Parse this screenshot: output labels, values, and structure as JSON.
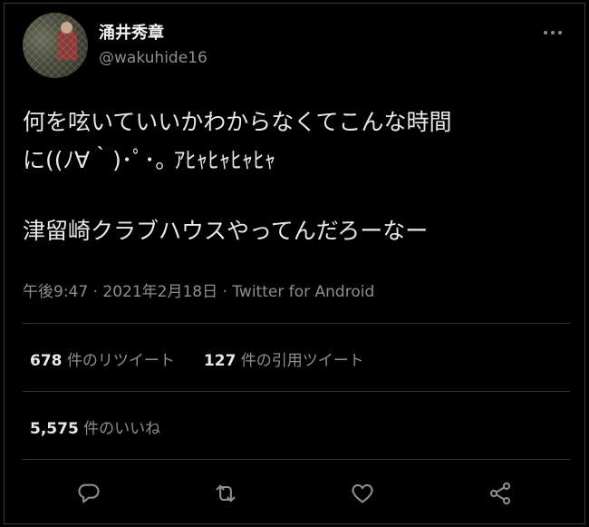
{
  "user": {
    "display_name": "涌井秀章",
    "handle": "@wakuhide16"
  },
  "tweet": {
    "line1": "何を呟いていいかわからなくてこんな時間",
    "line2": "に((ﾉ∀｀)･ﾟ･｡ ｱﾋｬﾋｬﾋｬﾋｬ",
    "line3": "津留崎クラブハウスやってんだろーなー"
  },
  "meta": {
    "time": "午後9:47",
    "separator1": " · ",
    "date": "2021年2月18日",
    "separator2": " · ",
    "source": "Twitter for Android"
  },
  "stats": {
    "retweets_count": "678",
    "retweets_label": " 件のリツイート",
    "quotes_count": "127",
    "quotes_label": " 件の引用ツイート",
    "likes_count": "5,575",
    "likes_label": " 件のいいね"
  },
  "icons": {
    "more": "more-horizontal-icon",
    "reply": "reply-icon",
    "retweet": "retweet-icon",
    "like": "heart-icon",
    "share": "share-icon"
  },
  "colors": {
    "background": "#000000",
    "text": "#e7e7e7",
    "secondary": "#8b8f93",
    "divider": "#333333"
  }
}
